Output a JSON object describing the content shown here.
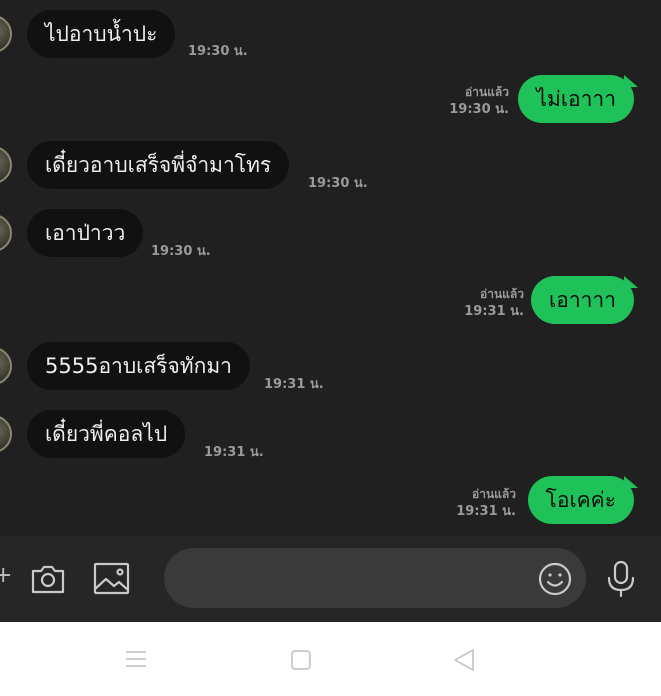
{
  "messages": [
    {
      "side": "in",
      "text": "ไปอาบน้ำปะ",
      "time": "19:30 น."
    },
    {
      "side": "out",
      "text": "ไม่เอาาา",
      "read": "อ่านแล้ว",
      "time": "19:30 น."
    },
    {
      "side": "in",
      "text": "เดี๋ยวอาบเสร็จพี่จำมาโทร",
      "time": "19:30 น."
    },
    {
      "side": "in",
      "text": "เอาป่าวว",
      "time": "19:30 น."
    },
    {
      "side": "out",
      "text": "เอาาาา",
      "read": "อ่านแล้ว",
      "time": "19:31 น."
    },
    {
      "side": "in",
      "text": "5555อาบเสร็จทักมา",
      "time": "19:31 น."
    },
    {
      "side": "in",
      "text": "เดี๋ยวพี่คอลไป",
      "time": "19:31 น."
    },
    {
      "side": "out",
      "text": "โอเคค่ะ",
      "read": "อ่านแล้ว",
      "time": "19:31 น."
    }
  ],
  "input": {
    "plus_glyph": "+",
    "placeholder": ""
  },
  "icons": {
    "camera": "camera-icon",
    "image": "image-icon",
    "emoji": "emoji-icon",
    "mic": "microphone-icon",
    "menu": "menu-icon",
    "home": "home-icon",
    "back": "back-icon"
  },
  "colors": {
    "outgoing": "#1ec258",
    "incoming": "#111111",
    "background": "#202020"
  }
}
